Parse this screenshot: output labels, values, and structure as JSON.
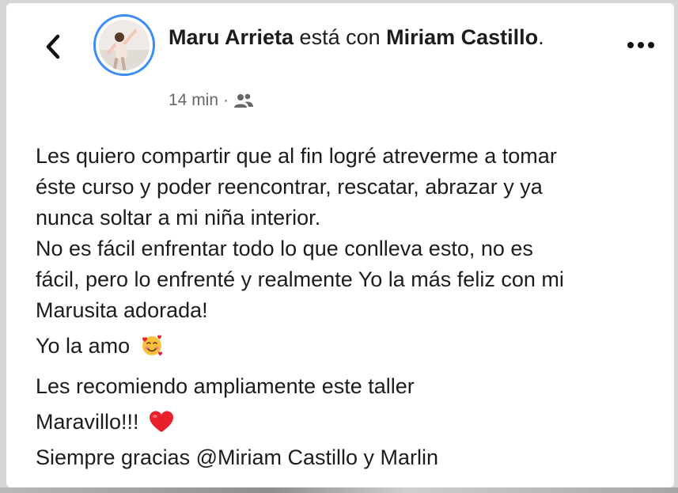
{
  "post": {
    "author": "Maru Arrieta",
    "with_text": " está con ",
    "tagged": "Miriam Castillo",
    "period": ".",
    "timestamp": "14 min",
    "separator": "·",
    "audience_icon": "friends-icon"
  },
  "icons": {
    "back": "chevron-left-icon",
    "more": "more-dots-icon"
  },
  "colors": {
    "text": "#1c1c1e",
    "meta": "#65676b",
    "avatar_ring": "#3b8df5",
    "heart": "#e8202c"
  },
  "body": {
    "lines": [
      "Les quiero compartir que al fin logré atreverme a tomar",
      "éste curso y poder reencontrar, rescatar, abrazar y ya",
      "nunca soltar a mi niña interior.",
      "No es fácil enfrentar todo lo que conlleva esto, no es",
      "fácil, pero lo enfrenté y realmente Yo la más feliz con mi",
      "Marusita adorada!"
    ],
    "love_line": "Yo la amo",
    "love_emoji": "smiling-face-with-hearts",
    "recommend_line": "Les recomiendo ampliamente este taller",
    "maravillo_line": "Maravillo!!!",
    "maravillo_emoji": "red-heart",
    "thanks_line": "Siempre gracias @Miriam Castillo y Marlin"
  }
}
